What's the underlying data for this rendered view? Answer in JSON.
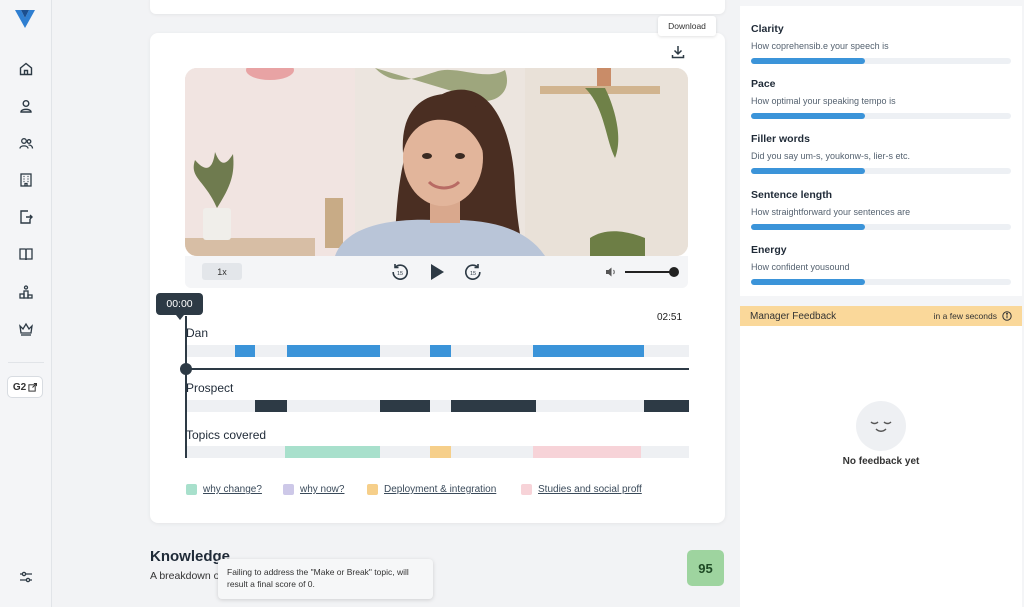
{
  "sidebar": {
    "logo": "brand-logo",
    "items": [
      {
        "name": "home",
        "icon": "home-icon"
      },
      {
        "name": "profile",
        "icon": "user-icon"
      },
      {
        "name": "team",
        "icon": "users-icon"
      },
      {
        "name": "library",
        "icon": "building-icon"
      },
      {
        "name": "export",
        "icon": "file-arrow-icon"
      },
      {
        "name": "playbook",
        "icon": "book-icon"
      },
      {
        "name": "leaderboard",
        "icon": "podium-icon"
      },
      {
        "name": "achievements",
        "icon": "crown-icon"
      }
    ],
    "g2_label": "G2",
    "settings_icon": "sliders-icon"
  },
  "player": {
    "download_label": "Download",
    "speed_label": "1x",
    "current_time": "00:00",
    "duration": "02:51",
    "volume_level": 1.0
  },
  "tracks": [
    {
      "label": "Dan",
      "color": "#3b94d9",
      "segments": [
        [
          0.095,
          0.135
        ],
        [
          0.2,
          0.385
        ],
        [
          0.485,
          0.525
        ],
        [
          0.69,
          0.91
        ]
      ]
    },
    {
      "label": "Prospect",
      "color": "#2d3a45",
      "segments": [
        [
          0.135,
          0.2
        ],
        [
          0.385,
          0.485
        ],
        [
          0.525,
          0.695
        ],
        [
          0.91,
          1.0
        ]
      ]
    },
    {
      "label": "Topics covered",
      "color": "",
      "segments": [
        [
          0.195,
          0.385,
          "#a8e0cc"
        ],
        [
          0.485,
          0.525,
          "#f6cf8a"
        ],
        [
          0.69,
          0.905,
          "#f7d3d8"
        ]
      ]
    }
  ],
  "legend": [
    {
      "label": "why change?",
      "color": "#a8e0cc"
    },
    {
      "label": "why now?",
      "color": "#cdc8e8"
    },
    {
      "label": "Deployment & integration",
      "color": "#f6cf8a"
    },
    {
      "label": "Studies and social proff",
      "color": "#f7d3d8"
    }
  ],
  "knowledge": {
    "title": "Knowledge",
    "description": "A breakdown o",
    "tooltip": "Failing to address the \"Make or Break\" topic, will result a final score of 0.",
    "score": "95"
  },
  "metrics": [
    {
      "title": "Clarity",
      "desc": "How coprehensib.e your speech is",
      "value": 0.44
    },
    {
      "title": "Pace",
      "desc": "How optimal your speaking tempo is",
      "value": 0.44
    },
    {
      "title": "Filler words",
      "desc": "Did you say um-s, youkonw-s, lier-s etc.",
      "value": 0.44
    },
    {
      "title": "Sentence length",
      "desc": "How straightforward your sentences are",
      "value": 0.44
    },
    {
      "title": "Energy",
      "desc": "How confident yousound",
      "value": 0.44
    }
  ],
  "manager_feedback": {
    "title": "Manager Feedback",
    "when": "in a few seconds",
    "empty": "No feedback yet"
  },
  "colors": {
    "accent": "#3b94d9",
    "dark": "#2d3a45",
    "feedback_header": "#fad89a",
    "score_bg": "#9ed49f"
  }
}
